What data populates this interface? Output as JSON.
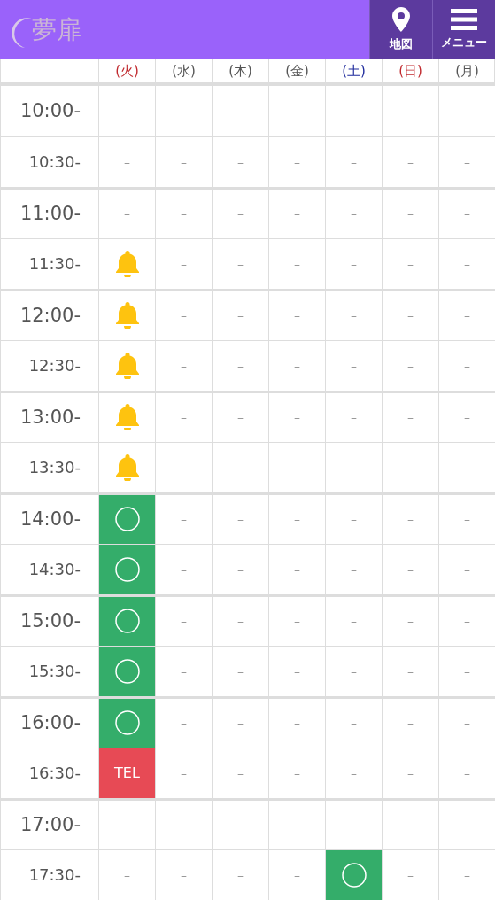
{
  "header": {
    "logo": "夢扉",
    "buttons": [
      {
        "kind": "map",
        "label": "地図"
      },
      {
        "kind": "menu",
        "label": "メニュー"
      }
    ]
  },
  "days": [
    {
      "label": "(火)",
      "color": "#c0282d"
    },
    {
      "label": "(水)",
      "color": "#555555"
    },
    {
      "label": "(木)",
      "color": "#555555"
    },
    {
      "label": "(金)",
      "color": "#555555"
    },
    {
      "label": "(土)",
      "color": "#1e2a9c"
    },
    {
      "label": "(日)",
      "color": "#c0282d"
    },
    {
      "label": "(月)",
      "color": "#555555"
    }
  ],
  "rows": [
    {
      "time": "10:00-",
      "hour": true,
      "cells": [
        {
          "kind": "none",
          "text": "–"
        },
        {
          "kind": "none",
          "text": "–"
        },
        {
          "kind": "none",
          "text": "–"
        },
        {
          "kind": "none",
          "text": "–"
        },
        {
          "kind": "none",
          "text": "–"
        },
        {
          "kind": "none",
          "text": "–"
        },
        {
          "kind": "none",
          "text": "–"
        }
      ]
    },
    {
      "time": "10:30-",
      "hour": false,
      "cells": [
        {
          "kind": "none",
          "text": "–"
        },
        {
          "kind": "none",
          "text": "–"
        },
        {
          "kind": "none",
          "text": "–"
        },
        {
          "kind": "none",
          "text": "–"
        },
        {
          "kind": "none",
          "text": "–"
        },
        {
          "kind": "none",
          "text": "–"
        },
        {
          "kind": "none",
          "text": "–"
        }
      ]
    },
    {
      "time": "11:00-",
      "hour": true,
      "cells": [
        {
          "kind": "none",
          "text": "–"
        },
        {
          "kind": "none",
          "text": "–"
        },
        {
          "kind": "none",
          "text": "–"
        },
        {
          "kind": "none",
          "text": "–"
        },
        {
          "kind": "none",
          "text": "–"
        },
        {
          "kind": "none",
          "text": "–"
        },
        {
          "kind": "none",
          "text": "–"
        }
      ]
    },
    {
      "time": "11:30-",
      "hour": false,
      "cells": [
        {
          "kind": "bell"
        },
        {
          "kind": "none",
          "text": "–"
        },
        {
          "kind": "none",
          "text": "–"
        },
        {
          "kind": "none",
          "text": "–"
        },
        {
          "kind": "none",
          "text": "–"
        },
        {
          "kind": "none",
          "text": "–"
        },
        {
          "kind": "none",
          "text": "–"
        }
      ]
    },
    {
      "time": "12:00-",
      "hour": true,
      "cells": [
        {
          "kind": "bell"
        },
        {
          "kind": "none",
          "text": "–"
        },
        {
          "kind": "none",
          "text": "–"
        },
        {
          "kind": "none",
          "text": "–"
        },
        {
          "kind": "none",
          "text": "–"
        },
        {
          "kind": "none",
          "text": "–"
        },
        {
          "kind": "none",
          "text": "–"
        }
      ]
    },
    {
      "time": "12:30-",
      "hour": false,
      "cells": [
        {
          "kind": "bell"
        },
        {
          "kind": "none",
          "text": "–"
        },
        {
          "kind": "none",
          "text": "–"
        },
        {
          "kind": "none",
          "text": "–"
        },
        {
          "kind": "none",
          "text": "–"
        },
        {
          "kind": "none",
          "text": "–"
        },
        {
          "kind": "none",
          "text": "–"
        }
      ]
    },
    {
      "time": "13:00-",
      "hour": true,
      "cells": [
        {
          "kind": "bell"
        },
        {
          "kind": "none",
          "text": "–"
        },
        {
          "kind": "none",
          "text": "–"
        },
        {
          "kind": "none",
          "text": "–"
        },
        {
          "kind": "none",
          "text": "–"
        },
        {
          "kind": "none",
          "text": "–"
        },
        {
          "kind": "none",
          "text": "–"
        }
      ]
    },
    {
      "time": "13:30-",
      "hour": false,
      "cells": [
        {
          "kind": "bell"
        },
        {
          "kind": "none",
          "text": "–"
        },
        {
          "kind": "none",
          "text": "–"
        },
        {
          "kind": "none",
          "text": "–"
        },
        {
          "kind": "none",
          "text": "–"
        },
        {
          "kind": "none",
          "text": "–"
        },
        {
          "kind": "none",
          "text": "–"
        }
      ]
    },
    {
      "time": "14:00-",
      "hour": true,
      "cells": [
        {
          "kind": "open"
        },
        {
          "kind": "none",
          "text": "–"
        },
        {
          "kind": "none",
          "text": "–"
        },
        {
          "kind": "none",
          "text": "–"
        },
        {
          "kind": "none",
          "text": "–"
        },
        {
          "kind": "none",
          "text": "–"
        },
        {
          "kind": "none",
          "text": "–"
        }
      ]
    },
    {
      "time": "14:30-",
      "hour": false,
      "cells": [
        {
          "kind": "open"
        },
        {
          "kind": "none",
          "text": "–"
        },
        {
          "kind": "none",
          "text": "–"
        },
        {
          "kind": "none",
          "text": "–"
        },
        {
          "kind": "none",
          "text": "–"
        },
        {
          "kind": "none",
          "text": "–"
        },
        {
          "kind": "none",
          "text": "–"
        }
      ]
    },
    {
      "time": "15:00-",
      "hour": true,
      "cells": [
        {
          "kind": "open"
        },
        {
          "kind": "none",
          "text": "–"
        },
        {
          "kind": "none",
          "text": "–"
        },
        {
          "kind": "none",
          "text": "–"
        },
        {
          "kind": "none",
          "text": "–"
        },
        {
          "kind": "none",
          "text": "–"
        },
        {
          "kind": "none",
          "text": "–"
        }
      ]
    },
    {
      "time": "15:30-",
      "hour": false,
      "cells": [
        {
          "kind": "open"
        },
        {
          "kind": "none",
          "text": "–"
        },
        {
          "kind": "none",
          "text": "–"
        },
        {
          "kind": "none",
          "text": "–"
        },
        {
          "kind": "none",
          "text": "–"
        },
        {
          "kind": "none",
          "text": "–"
        },
        {
          "kind": "none",
          "text": "–"
        }
      ]
    },
    {
      "time": "16:00-",
      "hour": true,
      "cells": [
        {
          "kind": "open"
        },
        {
          "kind": "none",
          "text": "–"
        },
        {
          "kind": "none",
          "text": "–"
        },
        {
          "kind": "none",
          "text": "–"
        },
        {
          "kind": "none",
          "text": "–"
        },
        {
          "kind": "none",
          "text": "–"
        },
        {
          "kind": "none",
          "text": "–"
        }
      ]
    },
    {
      "time": "16:30-",
      "hour": false,
      "cells": [
        {
          "kind": "tel",
          "text": "TEL"
        },
        {
          "kind": "none",
          "text": "–"
        },
        {
          "kind": "none",
          "text": "–"
        },
        {
          "kind": "none",
          "text": "–"
        },
        {
          "kind": "none",
          "text": "–"
        },
        {
          "kind": "none",
          "text": "–"
        },
        {
          "kind": "none",
          "text": "–"
        }
      ]
    },
    {
      "time": "17:00-",
      "hour": true,
      "cells": [
        {
          "kind": "none",
          "text": "–"
        },
        {
          "kind": "none",
          "text": "–"
        },
        {
          "kind": "none",
          "text": "–"
        },
        {
          "kind": "none",
          "text": "–"
        },
        {
          "kind": "none",
          "text": "–"
        },
        {
          "kind": "none",
          "text": "–"
        },
        {
          "kind": "none",
          "text": "–"
        }
      ]
    },
    {
      "time": "17:30-",
      "hour": false,
      "cells": [
        {
          "kind": "none",
          "text": "–"
        },
        {
          "kind": "none",
          "text": "–"
        },
        {
          "kind": "none",
          "text": "–"
        },
        {
          "kind": "none",
          "text": "–"
        },
        {
          "kind": "open"
        },
        {
          "kind": "none",
          "text": "–"
        },
        {
          "kind": "none",
          "text": "–"
        }
      ]
    }
  ]
}
